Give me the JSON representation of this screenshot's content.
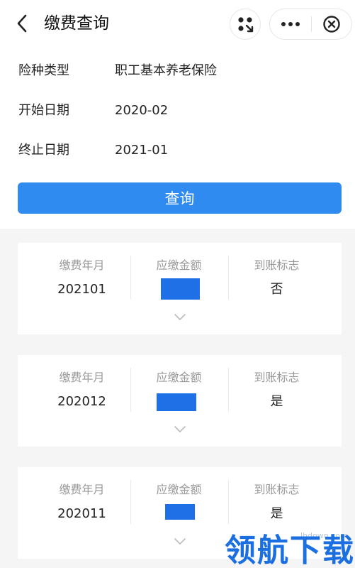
{
  "header": {
    "title": "缴费查询",
    "icons": {
      "back": "chevron-left-icon",
      "scan": "scan-icon",
      "more": "more-dots-icon",
      "close": "close-circle-icon"
    }
  },
  "form": {
    "rows": [
      {
        "label": "险种类型",
        "value": "职工基本养老保险"
      },
      {
        "label": "开始日期",
        "value": "2020-02"
      },
      {
        "label": "终止日期",
        "value": "2021-01"
      }
    ],
    "query_button": "查询"
  },
  "records": {
    "headers": {
      "month": "缴费年月",
      "amount": "应缴金额",
      "status": "到账标志"
    },
    "items": [
      {
        "month": "202101",
        "status": "否"
      },
      {
        "month": "202012",
        "status": "是"
      },
      {
        "month": "202011",
        "status": "是"
      }
    ]
  },
  "colors": {
    "accent": "#2f8bf0",
    "masked_amount": "#1f6fe6",
    "page_bg": "#f5f5f5"
  },
  "watermark": {
    "small": "lhdown.com",
    "big": "领航下载"
  }
}
